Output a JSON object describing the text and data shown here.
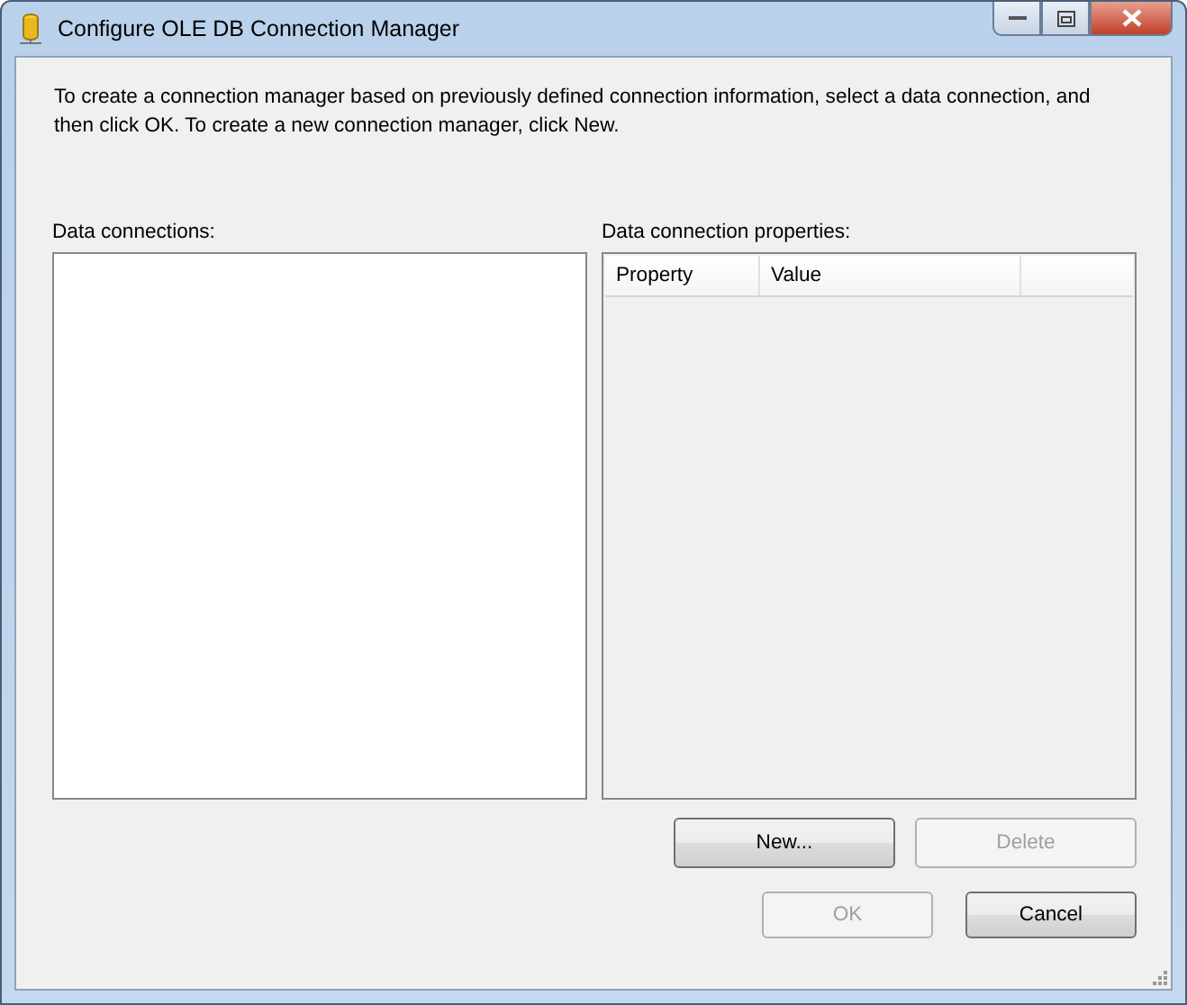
{
  "window": {
    "title": "Configure OLE DB Connection Manager"
  },
  "instructions": "To create a connection manager based on previously defined connection information, select a data connection, and then click OK. To create a new connection manager, click New.",
  "data_connections": {
    "label": "Data connections:"
  },
  "properties": {
    "label": "Data connection properties:",
    "columns": [
      "Property",
      "Value"
    ]
  },
  "buttons": [
    {
      "label": "New...",
      "disabled": false
    },
    {
      "label": "Delete",
      "disabled": true
    },
    {
      "label": "OK",
      "disabled": true
    },
    {
      "label": "Cancel",
      "disabled": false
    }
  ]
}
